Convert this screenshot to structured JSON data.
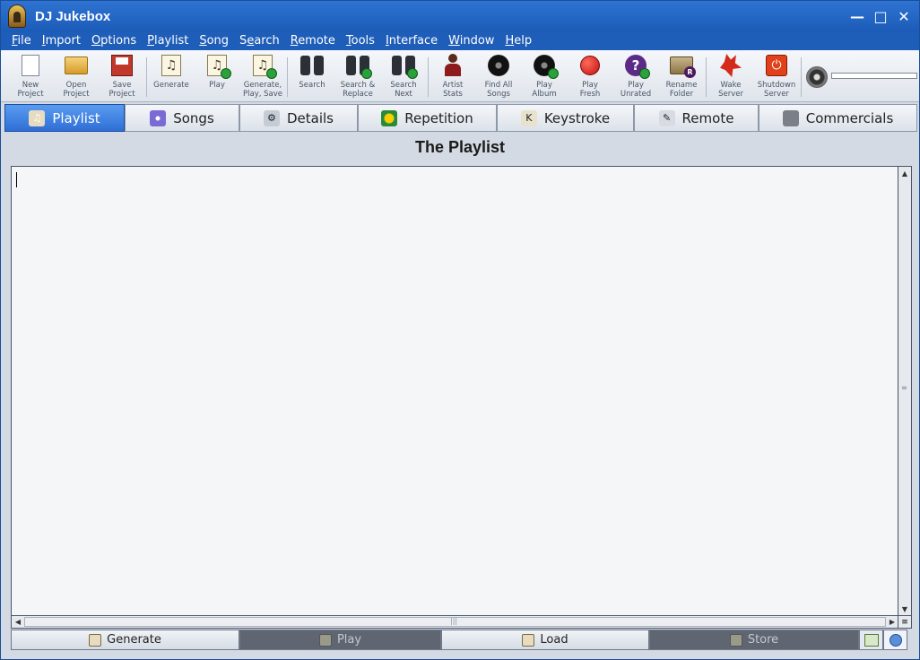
{
  "window": {
    "title": "DJ Jukebox"
  },
  "menu": [
    {
      "pre": "",
      "u": "F",
      "post": "ile"
    },
    {
      "pre": "",
      "u": "I",
      "post": "mport"
    },
    {
      "pre": "",
      "u": "O",
      "post": "ptions"
    },
    {
      "pre": "",
      "u": "P",
      "post": "laylist"
    },
    {
      "pre": "",
      "u": "S",
      "post": "ong"
    },
    {
      "pre": "S",
      "u": "e",
      "post": "arch"
    },
    {
      "pre": "",
      "u": "R",
      "post": "emote"
    },
    {
      "pre": "",
      "u": "T",
      "post": "ools"
    },
    {
      "pre": "",
      "u": "I",
      "post": "nterface"
    },
    {
      "pre": "",
      "u": "W",
      "post": "indow"
    },
    {
      "pre": "",
      "u": "H",
      "post": "elp"
    }
  ],
  "toolbar": [
    {
      "label": "New\nProject",
      "icon": "new-document-icon"
    },
    {
      "label": "Open\nProject",
      "icon": "open-folder-icon"
    },
    {
      "label": "Save\nProject",
      "icon": "save-disk-icon"
    },
    {
      "label": "Generate",
      "icon": "generate-playlist-icon"
    },
    {
      "label": "Play",
      "icon": "play-playlist-icon"
    },
    {
      "label": "Generate,\nPlay, Save",
      "icon": "generate-play-save-icon"
    },
    {
      "label": "Search",
      "icon": "binoculars-icon"
    },
    {
      "label": "Search &\nReplace",
      "icon": "search-replace-icon"
    },
    {
      "label": "Search\nNext",
      "icon": "search-next-icon"
    },
    {
      "label": "Artist\nStats",
      "icon": "artist-icon"
    },
    {
      "label": "Find All\nSongs",
      "icon": "find-songs-disc-icon"
    },
    {
      "label": "Play\nAlbum",
      "icon": "album-disc-icon"
    },
    {
      "label": "Play\nFresh",
      "icon": "apple-icon"
    },
    {
      "label": "Play\nUnrated",
      "icon": "question-mark-icon"
    },
    {
      "label": "Rename\nFolder",
      "icon": "rename-folder-icon"
    },
    {
      "label": "Wake\nServer",
      "icon": "wolf-icon"
    },
    {
      "label": "Shutdown\nServer",
      "icon": "power-icon"
    }
  ],
  "tabs": [
    {
      "label": "Playlist",
      "icon": "playlist-icon",
      "active": true
    },
    {
      "label": "Songs",
      "icon": "cd-icon",
      "active": false
    },
    {
      "label": "Details",
      "icon": "gears-icon",
      "active": false
    },
    {
      "label": "Repetition",
      "icon": "repeat-icon",
      "active": false
    },
    {
      "label": "Keystroke",
      "icon": "keystroke-icon",
      "active": false
    },
    {
      "label": "Remote",
      "icon": "remote-icon",
      "active": false
    },
    {
      "label": "Commercials",
      "icon": "commercials-icon",
      "active": false
    }
  ],
  "main": {
    "title": "The Playlist",
    "content": ""
  },
  "bottom": {
    "generate": "Generate",
    "play": "Play",
    "load": "Load",
    "store": "Store"
  },
  "colors": {
    "titlebar": "#2e73d2",
    "menubar": "#1e5db8",
    "active_tab": "#3c7fe0",
    "disabled_button": "#5f6672"
  }
}
